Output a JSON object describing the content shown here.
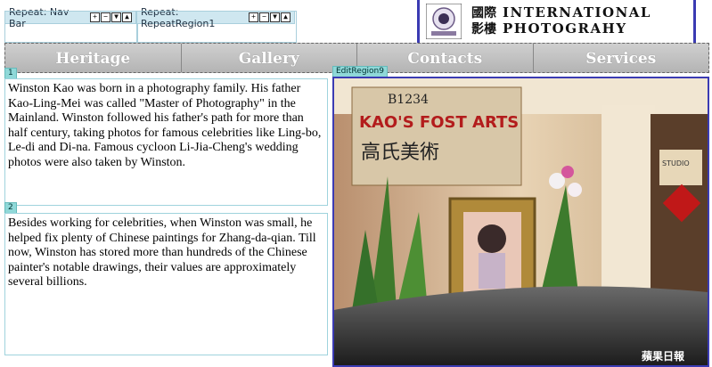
{
  "repeat_regions": [
    {
      "label": "Repeat: Nav Bar",
      "controls": [
        "+",
        "−",
        "▼",
        "▲"
      ]
    },
    {
      "label": "Repeat: RepeatRegion1",
      "controls": [
        "+",
        "−",
        "▼",
        "▲"
      ]
    }
  ],
  "logo": {
    "chinese_text": "國際\n影樓",
    "english_line1": "INTERNATIONAL",
    "english_line2": "PHOTOGRAHY"
  },
  "nav": {
    "items": [
      "Heritage",
      "Gallery",
      "Contacts",
      "Services"
    ]
  },
  "regions": {
    "region1_tag": "1",
    "region2_tag": "2",
    "edit_region_tag": "EditRegion9"
  },
  "content": {
    "paragraph1": "Winston Kao was born in a photography family. His father Kao-Ling-Mei was called \"Master of Photography\" in the Mainland. Winston followed his father's path for more than half century, taking photos for famous celebrities like Ling-bo, Le-di and Di-na. Famous cycloon Li-Jia-Cheng's wedding photos were also taken by Winston.",
    "paragraph2": "Besides working for celebrities, when Winston was small, he helped fix plenty of Chinese paintings for Zhang-da-qian. Till now, Winston has stored more than hundreds of the Chinese painter's notable drawings, their values are approximately several billions."
  },
  "photo": {
    "sign_number": "B1234",
    "sign_title": "KAO'S FOST ARTS",
    "sign_chinese": "高氏美術",
    "watermark": "蘋果日報",
    "side_sign": "STUDIO"
  },
  "colors": {
    "accent": "#3b3bb3",
    "region_tag": "#8fd8d8",
    "nav_bg": "#bdbdbd"
  }
}
